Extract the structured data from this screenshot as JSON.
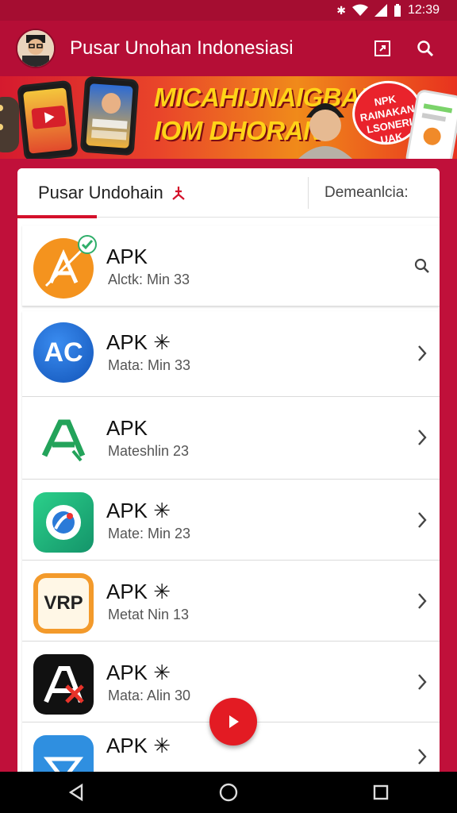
{
  "status_bar": {
    "time": "12:39"
  },
  "app_bar": {
    "title": "Pusar Unohan Indonesiasi"
  },
  "banner": {
    "headline_line1": "MICAHIJNAIGBAN",
    "headline_line2": "IOM DHORAN",
    "seal_line1": "NPK",
    "seal_line2": "RAINAKAN",
    "seal_line3": "LSONERI",
    "seal_line4": "UAK"
  },
  "tabs": [
    {
      "label": "Pusar Undohain"
    },
    {
      "label": "Demeanlcia:"
    }
  ],
  "apps": [
    {
      "name": "APK",
      "subtitle": "Alctk: Min 33",
      "action": "search-icon",
      "icon_color": "#f4931e"
    },
    {
      "name": "APK ✳",
      "subtitle": "Mata: Min 33",
      "action": "chevron-right-icon",
      "icon_color": "#1e6fd9"
    },
    {
      "name": "APK",
      "subtitle": "Mateshlin 23",
      "action": "chevron-right-icon",
      "icon_color": "#ffffff"
    },
    {
      "name": "APK ✳",
      "subtitle": "Mate: Min 23",
      "action": "chevron-right-icon",
      "icon_color": "#21b07a"
    },
    {
      "name": "APK ✳",
      "subtitle": "Metat Nin 13",
      "action": "chevron-right-icon",
      "icon_color": "#f39a2b"
    },
    {
      "name": "APK ✳",
      "subtitle": "Mata: Alin 30",
      "action": "chevron-right-icon",
      "icon_color": "#111111"
    },
    {
      "name": "APK ✳",
      "subtitle": "",
      "action": "chevron-right-icon",
      "icon_color": "#2f8fe0"
    }
  ],
  "colors": {
    "brand": "#c0103a",
    "accent": "#e31b23",
    "tab_indicator": "#d4102a"
  }
}
